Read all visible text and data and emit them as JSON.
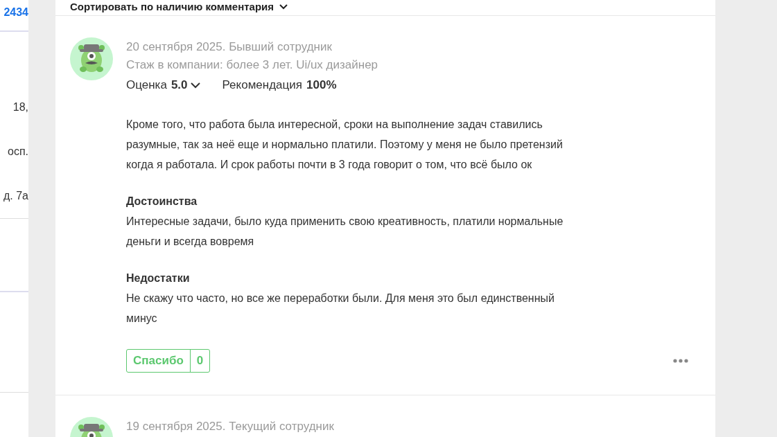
{
  "left_column": {
    "link": "2434",
    "fragments": [
      "18,",
      "осп.",
      "д. 7а"
    ]
  },
  "sort": {
    "label": "Сортировать по наличию комментария"
  },
  "reviews": [
    {
      "meta": "20 сентября 2025. Бывший сотрудник",
      "tenure": "Стаж в компании: более 3 лет. Ui/ux дизайнер",
      "rating_label": "Оценка",
      "rating": "5.0",
      "recommend_label": "Рекомендация",
      "recommend": "100%",
      "text": [
        "Кроме того, что работа была интересной, сроки на выполнение задач ставились",
        "разумные, так за неё еще и нормально платили. Поэтому у меня не было претензий",
        "когда я работала. И срок работы почти в 3 года говорит о том, что всё было ок"
      ],
      "sections": [
        {
          "title": "Достоинства",
          "lines": [
            "Интересные задачи, было куда применить свою креативность, платили нормальные",
            "деньги и всегда вовремя"
          ]
        },
        {
          "title": "Недостатки",
          "lines": [
            "Не скажу что часто, но все же переработки были. Для меня это был единственный",
            "минус"
          ]
        }
      ],
      "thanks": {
        "label": "Спасибо",
        "count": "0"
      }
    },
    {
      "meta": "19 сентября 2025. Текущий сотрудник"
    }
  ]
}
